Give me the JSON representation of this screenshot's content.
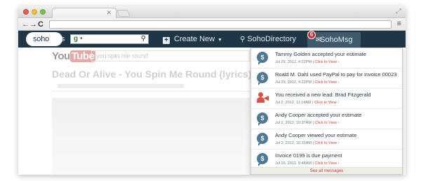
{
  "appnav": {
    "logo_text": "soho",
    "logo_suffix": "os",
    "google_glyph": "g",
    "create_new": "Create New",
    "directory": "SohoDirectory",
    "messages": "SohoMsg",
    "messages_badge": "6"
  },
  "youtube_bg": {
    "logo_you": "You",
    "logo_tube": "Tube",
    "search_text": "you spin me round",
    "video_title": "Dead Or Alive - You Spin Me Round (lyrics)"
  },
  "messages": {
    "items": [
      {
        "icon": "estimate-icon",
        "text": "Tammy Golden accepted your estimate",
        "date": "Jul 29, 2012, 4:22PM",
        "link": "Click to View ›"
      },
      {
        "icon": "payment-icon",
        "text": "Roald M. Dahl used PayPal to pay for invoice 00023",
        "date": "Jul 29, 2012, 4:22PM",
        "link": "Click to View ›"
      },
      {
        "icon": "lead-icon",
        "text": "You received a new lead: Brad Fitzgerald",
        "date": "Jul 2, 2012, 11:14AM",
        "link": "Click to View ›"
      },
      {
        "icon": "estimate-icon",
        "text": "Andy Cooper accepted your estimate",
        "date": "Jul 2, 2012, 10:37AM",
        "link": "Click to View ›"
      },
      {
        "icon": "estimate-icon",
        "text": "Andy Cooper viewed your estimate",
        "date": "Jul 2, 2012, 10:32AM",
        "link": "Click to View ›"
      },
      {
        "icon": "payment-icon",
        "text": "Invoice 0199 is due payment",
        "date": "Jul 29, 2012, 9:48AM",
        "link": "Click to View ›"
      }
    ],
    "see_all": "See all messages"
  },
  "colors": {
    "appbar": "#1f3647",
    "accent_red": "#d3403a",
    "icon_blue": "#4c7995"
  }
}
